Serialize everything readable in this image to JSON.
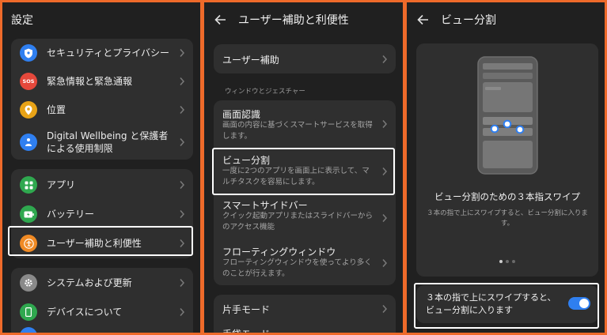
{
  "settings": {
    "title": "設定",
    "group1": [
      {
        "label": "セキュリティとプライバシー",
        "icon": "shield-icon",
        "color": "#2f7ff0"
      },
      {
        "label": "緊急情報と緊急通報",
        "icon": "sos-icon",
        "color": "#e5483b",
        "badge": "SOS"
      },
      {
        "label": "位置",
        "icon": "location-pin-icon",
        "color": "#e8a317"
      },
      {
        "label": "Digital Wellbeing と保護者による使用制限",
        "icon": "wellbeing-icon",
        "color": "#2f7ff0"
      }
    ],
    "group2": [
      {
        "label": "アプリ",
        "icon": "apps-grid-icon",
        "color": "#2fa84f"
      },
      {
        "label": "バッテリー",
        "icon": "battery-icon",
        "color": "#2fa84f"
      },
      {
        "label": "ユーザー補助と利便性",
        "icon": "accessibility-icon",
        "color": "#f08a24"
      }
    ],
    "group3": [
      {
        "label": "システムおよび更新",
        "icon": "gear-icon",
        "color": "#8a8a8a"
      },
      {
        "label": "デバイスについて",
        "icon": "phone-icon",
        "color": "#2fa84f"
      }
    ]
  },
  "accessibility": {
    "title": "ユーザー補助と利便性",
    "top_item": "ユーザー補助",
    "section_label": "ウィンドウとジェスチャー",
    "items": [
      {
        "title": "画面認識",
        "desc": "画面の内容に基づくスマートサービスを取得します。"
      },
      {
        "title": "ビュー分割",
        "desc": "一度に2つのアプリを画面上に表示して、マルチタスクを容易にします。"
      },
      {
        "title": "スマートサイドバー",
        "desc": "クイック起動アプリまたはスライドバーからのアクセス機能"
      },
      {
        "title": "フローティングウィンドウ",
        "desc": "フローティングウィンドウを使ってより多くのことが行えます。"
      }
    ],
    "bottom_items": [
      "片手モード",
      "手袋モード"
    ]
  },
  "split_view": {
    "title": "ビュー分割",
    "heading": "ビュー分割のための３本指スワイプ",
    "description": "３本の指で上にスワイプすると、ビュー分割に入ります。",
    "toggle_label": "３本の指で上にスワイプすると、ビュー分割に入ります",
    "toggle_on": true,
    "page_indicator": {
      "current": 1,
      "total": 3
    },
    "accent": "#2f7ff0"
  },
  "colors": {
    "highlight_border": "#ffffff",
    "frame_border": "#ee6a2a"
  }
}
